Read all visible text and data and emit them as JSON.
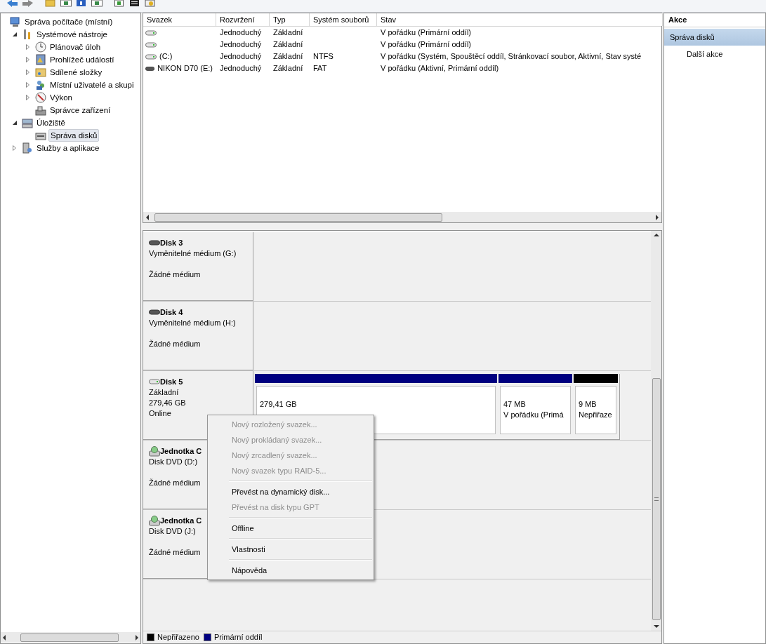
{
  "tree": [
    {
      "label": "Správa počítače (místní)",
      "expandable": false,
      "selected": false,
      "children": [
        {
          "label": "Systémové nástroje",
          "expandable": true,
          "expanded": true,
          "selected": false,
          "children": [
            {
              "label": "Plánovač úloh",
              "expandable": true,
              "expanded": false,
              "selected": false
            },
            {
              "label": "Prohlížeč událostí",
              "expandable": true,
              "expanded": false,
              "selected": false
            },
            {
              "label": "Sdílené složky",
              "expandable": true,
              "expanded": false,
              "selected": false
            },
            {
              "label": "Místní uživatelé a skupi",
              "expandable": true,
              "expanded": false,
              "selected": false
            },
            {
              "label": "Výkon",
              "expandable": true,
              "expanded": false,
              "selected": false
            },
            {
              "label": "Správce zařízení",
              "expandable": false,
              "selected": false
            }
          ]
        },
        {
          "label": "Úložiště",
          "expandable": true,
          "expanded": true,
          "selected": false,
          "children": [
            {
              "label": "Správa disků",
              "expandable": false,
              "selected": true
            }
          ]
        },
        {
          "label": "Služby a aplikace",
          "expandable": true,
          "expanded": false,
          "selected": false
        }
      ]
    }
  ],
  "volumes": {
    "columns": [
      "Svazek",
      "Rozvržení",
      "Typ",
      "Systém souborů",
      "Stav"
    ],
    "rows": [
      {
        "kind": "fixed",
        "cells": [
          "",
          "Jednoduchý",
          "Základní",
          "",
          "V pořádku (Primární oddíl)"
        ]
      },
      {
        "kind": "fixed",
        "cells": [
          "",
          "Jednoduchý",
          "Základní",
          "",
          "V pořádku (Primární oddíl)"
        ]
      },
      {
        "kind": "fixed",
        "cells": [
          "(C:)",
          "Jednoduchý",
          "Základní",
          "NTFS",
          "V pořádku (Systém, Spouštěcí oddíl, Stránkovací soubor, Aktivní, Stav systé"
        ]
      },
      {
        "kind": "removable",
        "cells": [
          "NIKON D70 (E:)",
          "Jednoduchý",
          "Základní",
          "FAT",
          "V pořádku (Aktivní, Primární oddíl)"
        ]
      }
    ]
  },
  "disks": [
    {
      "kind": "removable",
      "name": "Disk 3",
      "type": "Vyměnitelné médium (G:)",
      "status": "Žádné médium"
    },
    {
      "kind": "removable",
      "name": "Disk 4",
      "type": "Vyměnitelné médium (H:)",
      "status": "Žádné médium"
    },
    {
      "kind": "basic",
      "name": "Disk 5",
      "type": "Základní",
      "size": "279,46 GB",
      "status": "Online",
      "partitions": [
        {
          "size": "279,41 GB",
          "color": "#000080"
        },
        {
          "size": "47 MB",
          "status": "V pořádku (Primá",
          "color": "#000080"
        },
        {
          "size": "9 MB",
          "status": "Nepřiřaze",
          "color": "#000000"
        }
      ]
    },
    {
      "kind": "cdrom",
      "name": "Jednotka C",
      "type": "Disk DVD (D:)",
      "status": "Žádné médium"
    },
    {
      "kind": "cdrom",
      "name": "Jednotka C",
      "type": "Disk DVD (J:)",
      "status": "Žádné médium"
    }
  ],
  "context_menu": [
    {
      "label": "Nový rozložený svazek...",
      "disabled": true,
      "separator_before": false
    },
    {
      "label": "Nový prokládaný svazek...",
      "disabled": true,
      "separator_before": false
    },
    {
      "label": "Nový zrcadlený svazek...",
      "disabled": true,
      "separator_before": false
    },
    {
      "label": "Nový svazek typu RAID-5...",
      "disabled": true,
      "separator_before": false
    },
    {
      "label": "Převést na dynamický disk...",
      "disabled": false,
      "separator_before": true
    },
    {
      "label": "Převést na disk typu GPT",
      "disabled": true,
      "separator_before": false
    },
    {
      "label": "Offline",
      "disabled": false,
      "separator_before": true
    },
    {
      "label": "Vlastnosti",
      "disabled": false,
      "separator_before": true
    },
    {
      "label": "Nápověda",
      "disabled": false,
      "separator_before": true
    }
  ],
  "legend": [
    {
      "label": "Nepřiřazeno",
      "color": "#000000"
    },
    {
      "label": "Primární oddíl",
      "color": "#000080"
    }
  ],
  "actions": {
    "title": "Akce",
    "items": [
      {
        "kind": "section",
        "label": "Správa disků"
      },
      {
        "kind": "item",
        "label": "Další akce"
      }
    ]
  }
}
